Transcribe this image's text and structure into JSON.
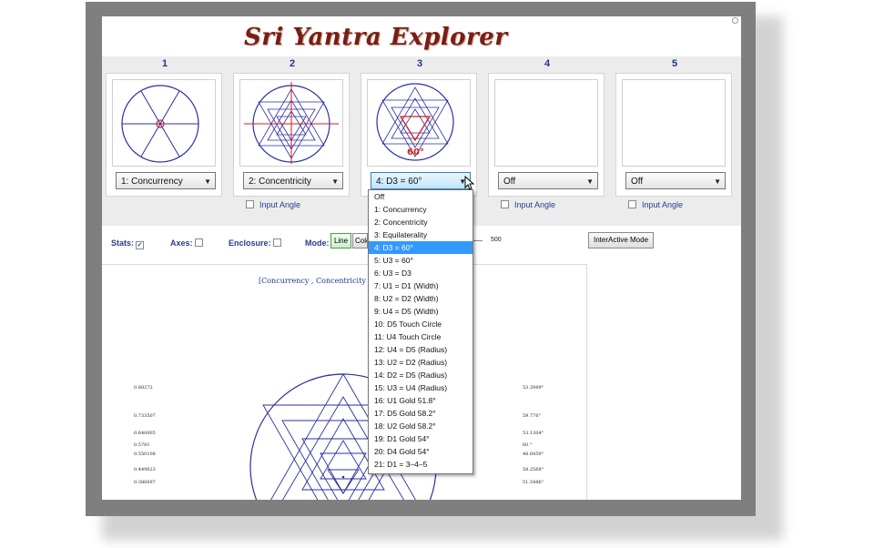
{
  "app": {
    "title": "Sri Yantra Explorer"
  },
  "slots": [
    {
      "number": "1",
      "selection": "1:  Concurrency"
    },
    {
      "number": "2",
      "selection": "2:  Concentricity"
    },
    {
      "number": "3",
      "selection": "4:  D3 = 60°",
      "angle_label": "60°"
    },
    {
      "number": "4",
      "selection": "Off",
      "input_angle": "Input Angle"
    },
    {
      "number": "5",
      "selection": "Off",
      "input_angle": "Input Angle"
    }
  ],
  "input_angle_label": "Input Angle",
  "controls": {
    "stats_label": "Stats:",
    "stats_checked": true,
    "axes_label": "Axes:",
    "axes_checked": false,
    "enclosure_label": "Enclosure:",
    "enclosure_checked": false,
    "mode_label": "Mode:",
    "mode_line": "Line",
    "mode_color": "Colo",
    "slider_value": "500",
    "interactive_button": "InterActive Mode"
  },
  "formula_text": "[Concurrency , Concentricity , D3",
  "stats_left": [
    "0.88272",
    "0.733507",
    "0.640005",
    "0.5781",
    "0.550108",
    "0.449623",
    "0.386697"
  ],
  "stats_right": [
    "53.2989°",
    "59.776°",
    "53.1304°",
    "60.°",
    "48.8459°",
    "58.2568°",
    "51.5486°"
  ],
  "dropdown": {
    "selected_index": 4,
    "options": [
      "Off",
      "1:  Concurrency",
      "2:  Concentricity",
      "3:  Equilaterality",
      "4:  D3 = 60°",
      "5:  U3 = 60°",
      "6:  U3 = D3",
      "7:  U1 = D1 (Width)",
      "8:  U2 = D2 (Width)",
      "9:  U4 = D5 (Width)",
      "10:  D5 Touch Circle",
      "11:  U4 Touch Circle",
      "12:  U4 = D5 (Radius)",
      "13:  U2 = D2 (Radius)",
      "14:  D2 = D5 (Radius)",
      "15:  U3 = U4 (Radius)",
      "16:  U1 Gold 51.8°",
      "17:  D5 Gold 58.2°",
      "18:  U2 Gold 58.2°",
      "19:  D1 Gold 54°",
      "20:  D4 Gold 54°",
      "21:  D1 = 3–4–5"
    ]
  },
  "colors": {
    "accent": "#1c3a8a",
    "figure": "#2b2fa0",
    "highlight": "#3399ff",
    "red": "#d81b1b",
    "title": "#7a1d12"
  }
}
